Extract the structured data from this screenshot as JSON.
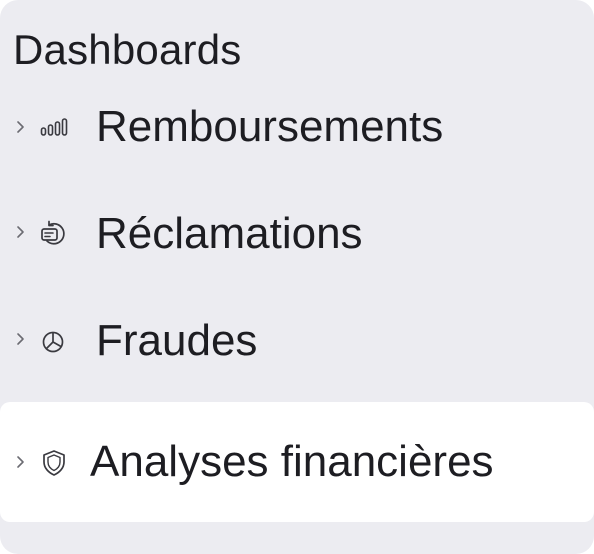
{
  "sidebar": {
    "section_title": "Dashboards",
    "items": [
      {
        "label": "Remboursements",
        "icon": "bar-chart-icon",
        "active": false
      },
      {
        "label": "Réclamations",
        "icon": "refresh-card-icon",
        "active": false
      },
      {
        "label": "Fraudes",
        "icon": "pie-chart-icon",
        "active": false
      },
      {
        "label": "Analyses financières",
        "icon": "shield-icon",
        "active": true
      }
    ]
  },
  "colors": {
    "panel_background": "#ececf1",
    "active_background": "#ffffff",
    "text": "#1d1d22",
    "icon": "#3a3a40",
    "chevron": "#6b6b72"
  }
}
